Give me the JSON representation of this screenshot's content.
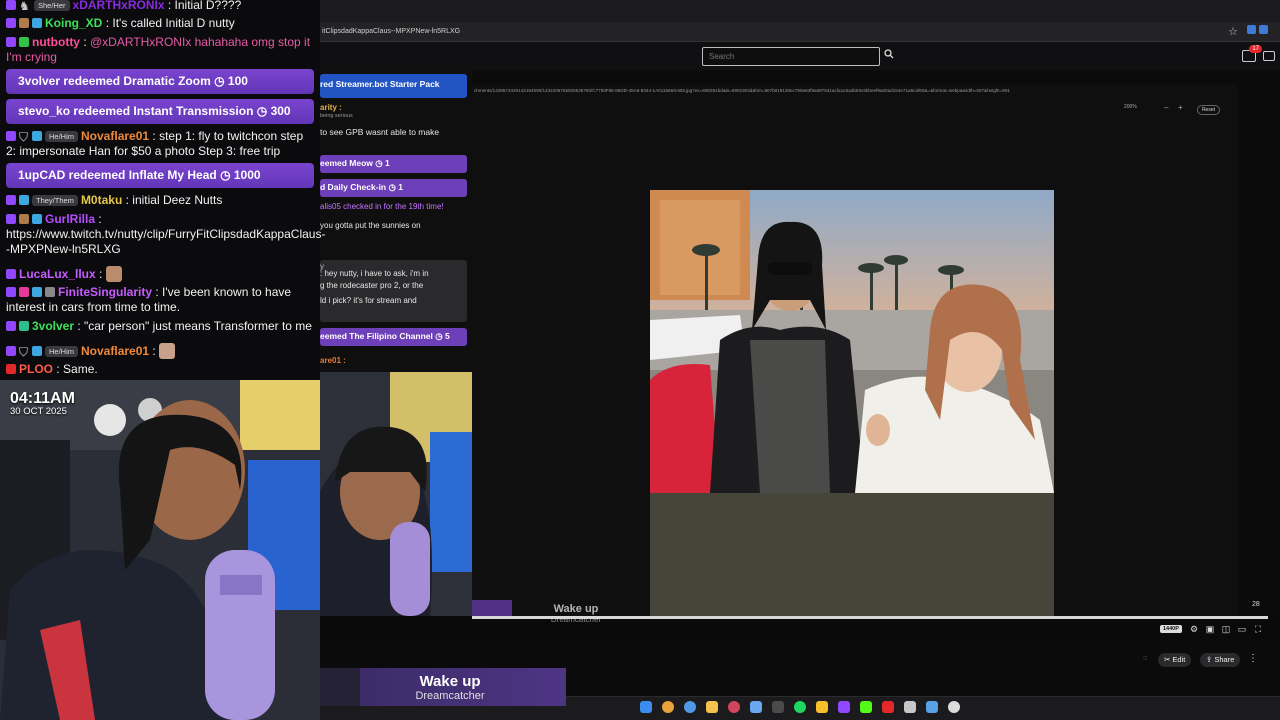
{
  "browser": {
    "tab_url": "itClipsdadKappaClaus--MPXPNew-ln5RLXG",
    "search_placeholder": "Search",
    "notification_count": "17",
    "image_url": "chments/1429573440142184590/1432206765025525760/C7793F85-89DD-45A8-8344-1A011566SAB5.jpg?ex=690391bd&is=6902303d&hm=807b819130ec799a63f9a687531acfa1e2a3b83c6bbeef9a60ad154e71a5caf60&=&format=webp&width=507&height=901",
    "zoom_level": "200%",
    "zoom_minus": "–",
    "zoom_plus": "+",
    "reset_label": "Reset"
  },
  "player": {
    "elapsed": "28",
    "quality": "1440P",
    "progress": 1.0,
    "edit_label": "Edit",
    "share_label": "Share",
    "ghost_title": "Wake up",
    "ghost_artist": "Dreamcatcher"
  },
  "chat2": {
    "banner_top": "red Streamer.bot Starter Pack",
    "user_line": "arity :",
    "small_line": "being serious",
    "gpb_line": "to see GPB wasnt able to make",
    "meow": "eemed Meow ◷ 1",
    "checkin": "d Daily Check-in ◷ 1",
    "checkin_msg": "alis05 checked in for the 19th time!",
    "sunnies": "you gotta put the sunnies on",
    "box_l0": "y",
    "box_l1": ": hey nutty, i have to ask, i'm in",
    "box_l2": "g the rodecaster pro 2, or the",
    "box_l3": "ld i pick? it's for stream and",
    "filipino": "eemed The Filipino Channel ◷ 5",
    "flare": "are01 :"
  },
  "chat": {
    "m0_pron": "She/Her",
    "m0_user": "xDARTHxRONIx",
    "m0_text": ": Initial D????",
    "m1_user": "Koing_XD",
    "m1_text": ": It's called Initial D nutty",
    "m2_user": "nutbotty",
    "m2_text": ": ",
    "m2_mention": "@xDARTHxRONIx hahahaha omg stop it I'm crying",
    "r1_text": "3volver redeemed Dramatic Zoom",
    "r1_pts": "◷ 100",
    "r2_text": "stevo_ko redeemed Instant Transmission",
    "r2_pts": "◷ 300",
    "m3_pron": "He/Him",
    "m3_user": "Novaflare01",
    "m3_text": ": step 1: fly to twitchcon step 2: impersonate Han for $50 a photo Step 3: free trip",
    "r3_text": "1upCAD redeemed Inflate My Head",
    "r3_pts": "◷ 1000",
    "m4_pron": "They/Them",
    "m4_user": "M0taku",
    "m4_text": ": initial Deez Nutts",
    "m5_user": "GurlRilla",
    "m5_text": ":",
    "m5_link": "https://www.twitch.tv/nutty/clip/FurryFitClipsdadKappaClaus--MPXPNew-ln5RLXG",
    "m6_user": "LucaLux_llux",
    "m6_text": ":",
    "m7_user": "FiniteSingularity",
    "m7_text": ": I've been known to have interest in cars from time to time.",
    "m8_user": "3volver",
    "m8_text": ": \"car person\" just means Transformer to me",
    "m9_pron": "He/Him",
    "m9_user": "Novaflare01",
    "m9_text": ":",
    "m10_user": "PLOO",
    "m10_text": ": Same."
  },
  "overlay": {
    "time": "04:11AM",
    "date": "30 OCT 2025",
    "song_title": "Wake up",
    "song_artist": "Dreamcatcher"
  },
  "colors": {
    "accent_purple": "#6d3fb8",
    "brand_twitch": "#9146ff",
    "youtube_red": "#e3272b"
  }
}
